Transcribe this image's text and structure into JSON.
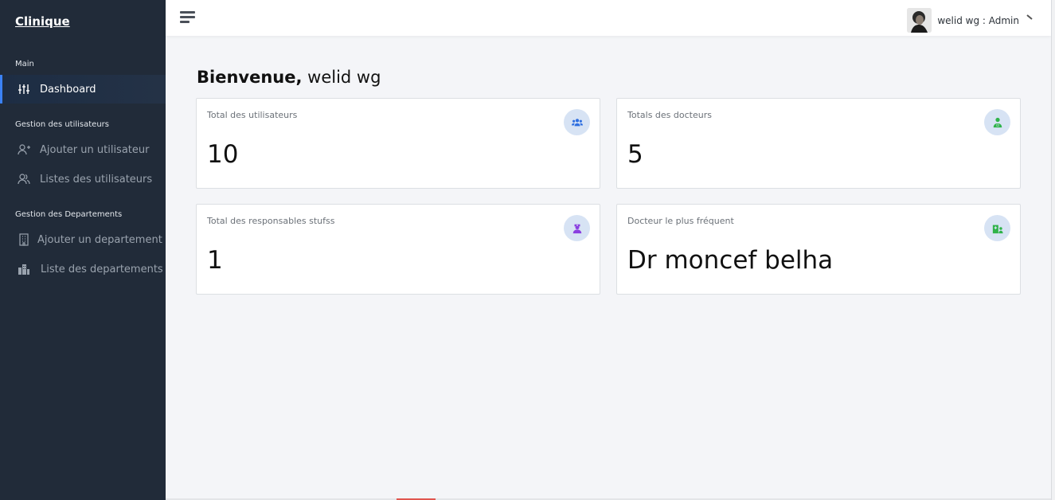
{
  "sidebar": {
    "brand": "Clinique",
    "sections": [
      {
        "title": "Main"
      },
      {
        "title": "Gestion des utilisateurs"
      },
      {
        "title": "Gestion des Departements"
      }
    ],
    "items": [
      {
        "label": "Dashboard",
        "icon": "sliders-icon",
        "active": true
      },
      {
        "label": "Ajouter un utilisateur",
        "icon": "user-add-icon"
      },
      {
        "label": "Listes des utilisateurs",
        "icon": "users-icon"
      },
      {
        "label": "Ajouter un departement",
        "icon": "building-icon"
      },
      {
        "label": "Liste des departements",
        "icon": "city-icon"
      }
    ],
    "accent": "#3b82f6",
    "background": "#212b39"
  },
  "header": {
    "menu_icon": "hamburger-icon",
    "user": {
      "name": "welid wg : Admin",
      "avatar": "avatar-photo"
    }
  },
  "main": {
    "welcome_bold": "Bienvenue,",
    "welcome_name": "welid wg",
    "cards": [
      {
        "label": "Total des utilisateurs",
        "value": "10",
        "icon": "users-group-icon",
        "icon_color": "#2f6fe0"
      },
      {
        "label": "Totals des docteurs",
        "value": "5",
        "icon": "doctor-icon",
        "icon_color": "#2fb34a"
      },
      {
        "label": "Total des responsables stufss",
        "value": "1",
        "icon": "nurse-icon",
        "icon_color": "#8a3fe0"
      },
      {
        "label": "Docteur le plus fréquent",
        "value": "Dr moncef belha",
        "icon": "hospital-user-icon",
        "icon_color": "#2fb34a"
      }
    ]
  }
}
